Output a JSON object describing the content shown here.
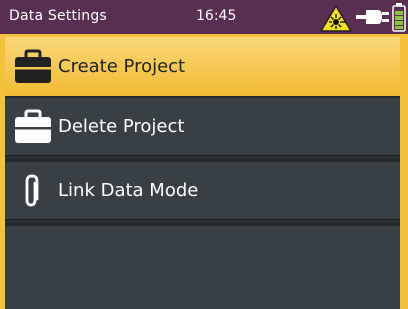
{
  "status_bar": {
    "title": "Data Settings",
    "time": "16:45",
    "icons": [
      "laser-warning-icon",
      "power-plug-icon",
      "battery-icon"
    ],
    "color": "#5a2e52"
  },
  "menu": {
    "items": [
      {
        "label": "Create Project",
        "icon": "briefcase-icon",
        "selected": true
      },
      {
        "label": "Delete Project",
        "icon": "briefcase-icon",
        "selected": false
      },
      {
        "label": "Link Data Mode",
        "icon": "paperclip-icon",
        "selected": false
      }
    ]
  },
  "colors": {
    "accent": "#f3c23a",
    "menu_bg": "#384045",
    "frame": "#2b3236"
  }
}
